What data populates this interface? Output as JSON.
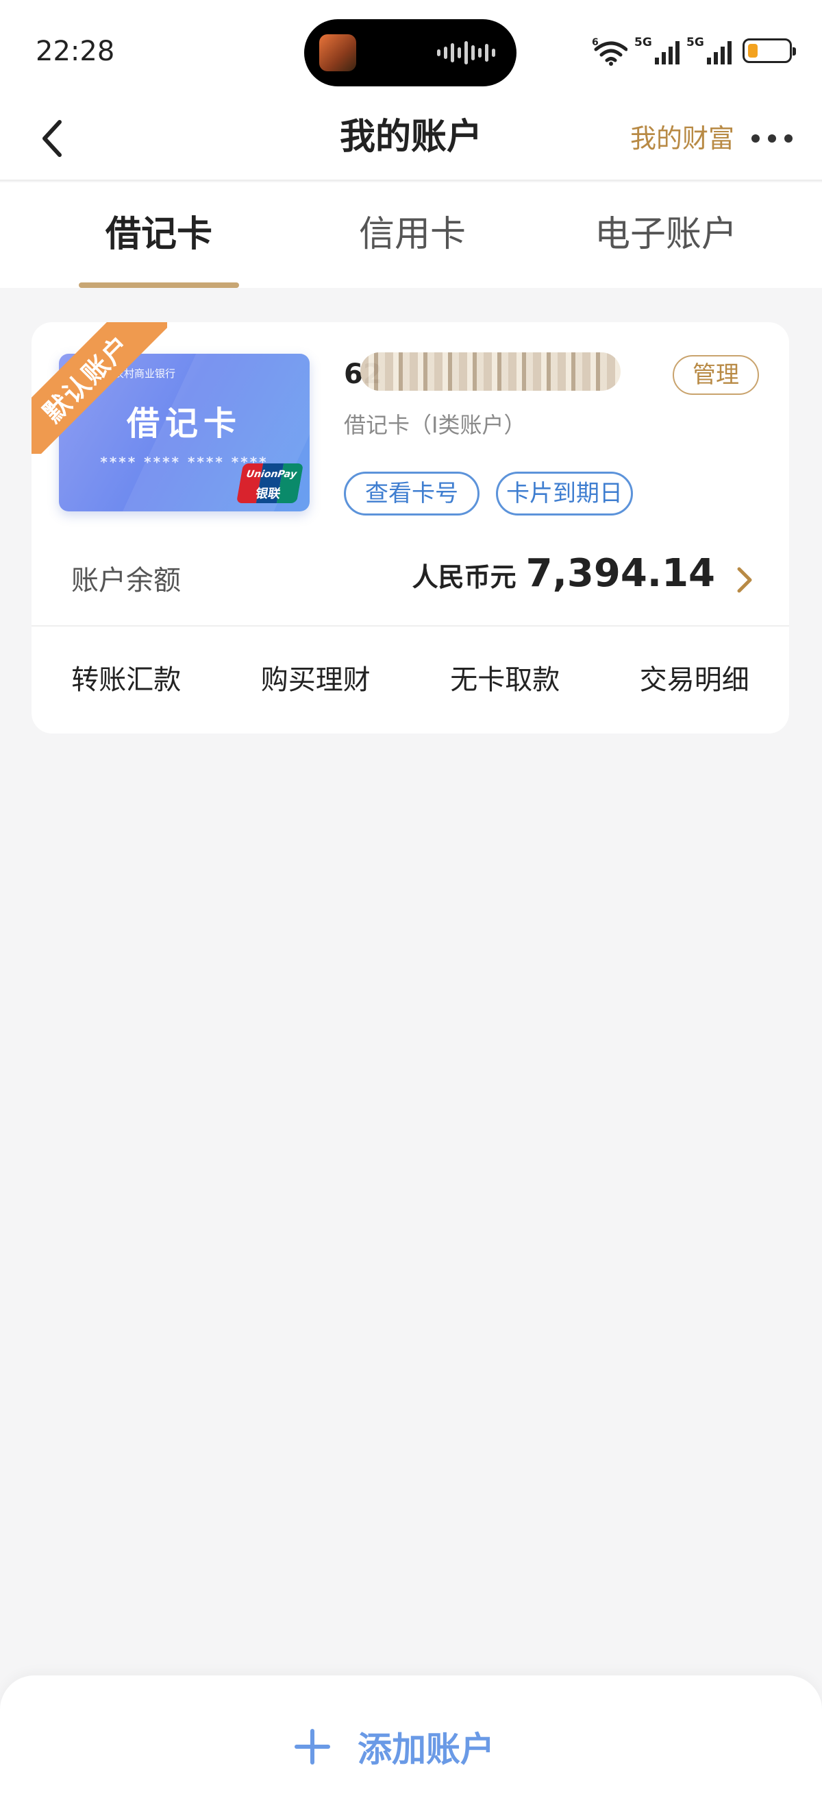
{
  "status_bar": {
    "time": "22:28",
    "network_1": "5G",
    "network_2": "5G",
    "wifi_badge": "6"
  },
  "navbar": {
    "title": "我的账户",
    "wealth_link": "我的财富"
  },
  "tabs": [
    {
      "label": "借记卡",
      "active": true
    },
    {
      "label": "信用卡",
      "active": false
    },
    {
      "label": "电子账户",
      "active": false
    }
  ],
  "account_card": {
    "default_badge": "默认账户",
    "bank_card_title": "借记卡",
    "bank_card_mask": "**** **** **** ****",
    "bank_name": "江苏农村商业银行",
    "unionpay_en": "UnionPay",
    "unionpay_cn": "银联",
    "card_number_prefix": "62",
    "manage_label": "管理",
    "card_type": "借记卡（I类账户）",
    "view_number_label": "查看卡号",
    "expiry_label": "卡片到期日",
    "balance_label": "账户余额",
    "currency": "人民币元",
    "balance": "7,394.14"
  },
  "quick_actions": [
    {
      "label": "转账汇款"
    },
    {
      "label": "购买理财"
    },
    {
      "label": "无卡取款"
    },
    {
      "label": "交易明细"
    }
  ],
  "bottom": {
    "add_account_label": "添加账户"
  },
  "colors": {
    "accent_gold": "#b88a45",
    "link_blue": "#3f7ed0",
    "ribbon_orange": "#ef9a4f"
  }
}
